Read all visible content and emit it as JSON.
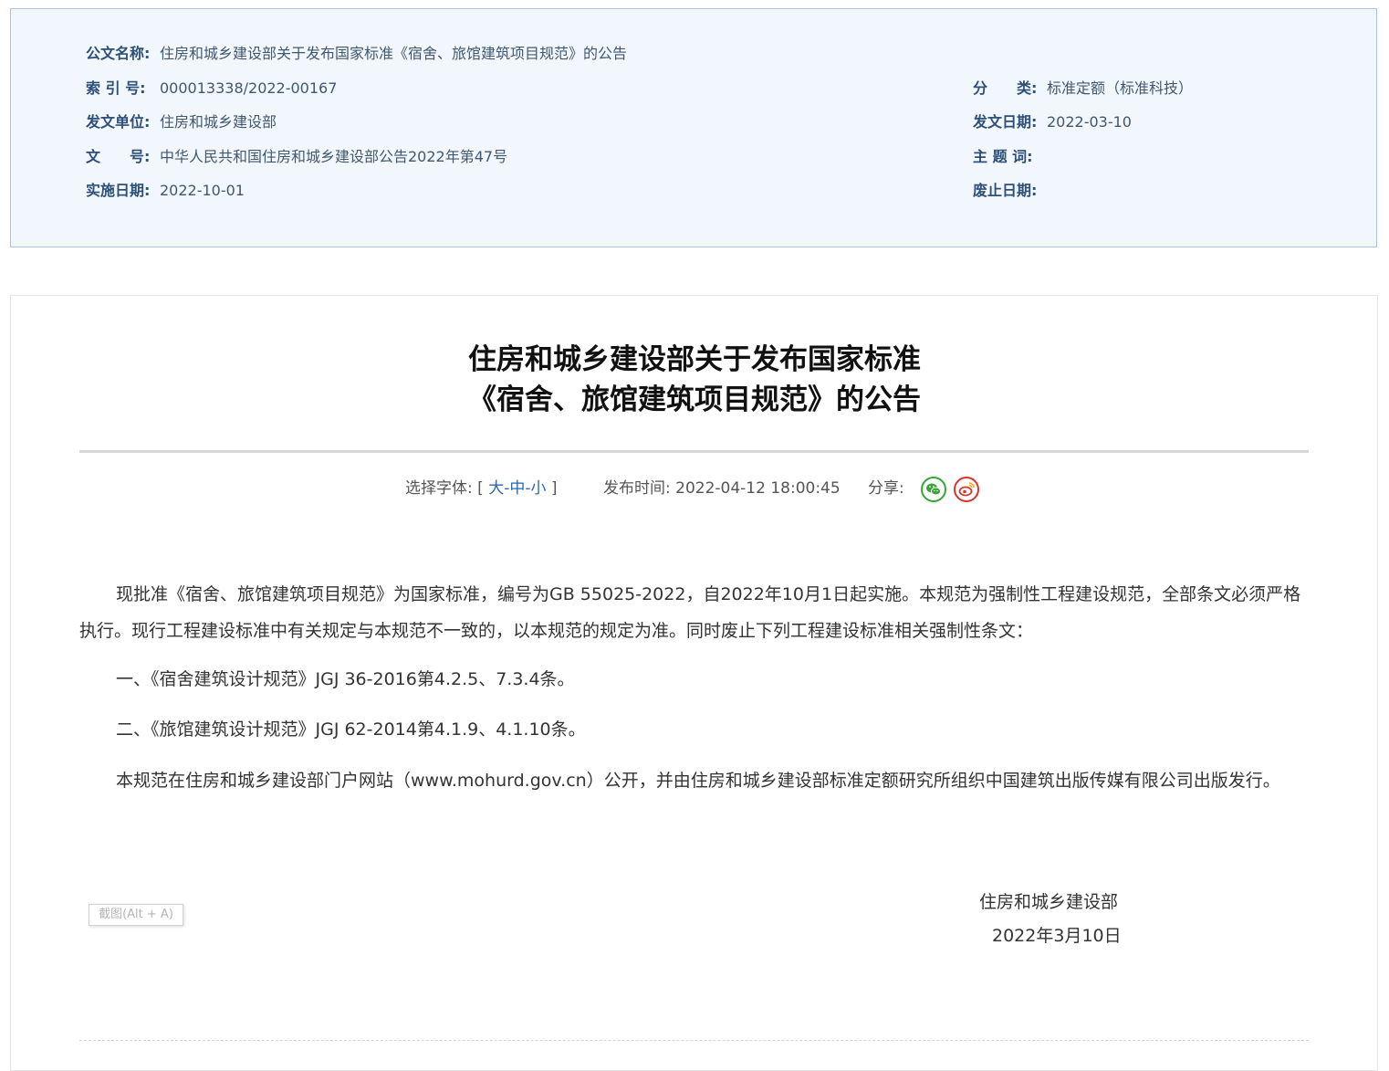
{
  "meta": {
    "left": [
      {
        "label": "公文名称:",
        "value": "住房和城乡建设部关于发布国家标准《宿舍、旅馆建筑项目规范》的公告"
      },
      {
        "label": "索 引 号:",
        "value": "000013338/2022-00167"
      },
      {
        "label": "发文单位:",
        "value": "住房和城乡建设部"
      },
      {
        "label": "文　　号:",
        "value": "中华人民共和国住房和城乡建设部公告2022年第47号"
      },
      {
        "label": "实施日期:",
        "value": "2022-10-01"
      }
    ],
    "right": [
      {
        "label": "分　　类:",
        "value": "标准定额（标准科技）"
      },
      {
        "label": "发文日期:",
        "value": "2022-03-10"
      },
      {
        "label": "主 题 词:",
        "value": ""
      },
      {
        "label": "废止日期:",
        "value": ""
      }
    ]
  },
  "article": {
    "title_line1": "住房和城乡建设部关于发布国家标准",
    "title_line2": "《宿舍、旅馆建筑项目规范》的公告",
    "font_select_label": "选择字体:",
    "font_open": "[",
    "font_large": "大",
    "font_medium": "中",
    "font_small": "小",
    "font_sep": "-",
    "font_close": "]",
    "publish_label": "发布时间:",
    "publish_time": "2022-04-12 18:00:45",
    "share_label": "分享:",
    "paragraphs": [
      "现批准《宿舍、旅馆建筑项目规范》为国家标准，编号为GB 55025-2022，自2022年10月1日起实施。本规范为强制性工程建设规范，全部条文必须严格执行。现行工程建设标准中有关规定与本规范不一致的，以本规范的规定为准。同时废止下列工程建设标准相关强制性条文：",
      "一、《宿舍建筑设计规范》JGJ 36-2016第4.2.5、7.3.4条。",
      "二、《旅馆建筑设计规范》JGJ 62-2014第4.1.9、4.1.10条。",
      "本规范在住房和城乡建设部门户网站（www.mohurd.gov.cn）公开，并由住房和城乡建设部标准定额研究所组织中国建筑出版传媒有限公司出版发行。"
    ],
    "signature_org": "住房和城乡建设部",
    "signature_date": "2022年3月10日"
  },
  "tooltip": {
    "text": "截图(Alt + A)"
  },
  "colors": {
    "meta_bg": "#f2f7fd",
    "meta_border": "#a9c2dd",
    "label": "#2d4f78",
    "link": "#2b66b0",
    "wechat": "#3aa336",
    "weibo": "#d9342b"
  }
}
